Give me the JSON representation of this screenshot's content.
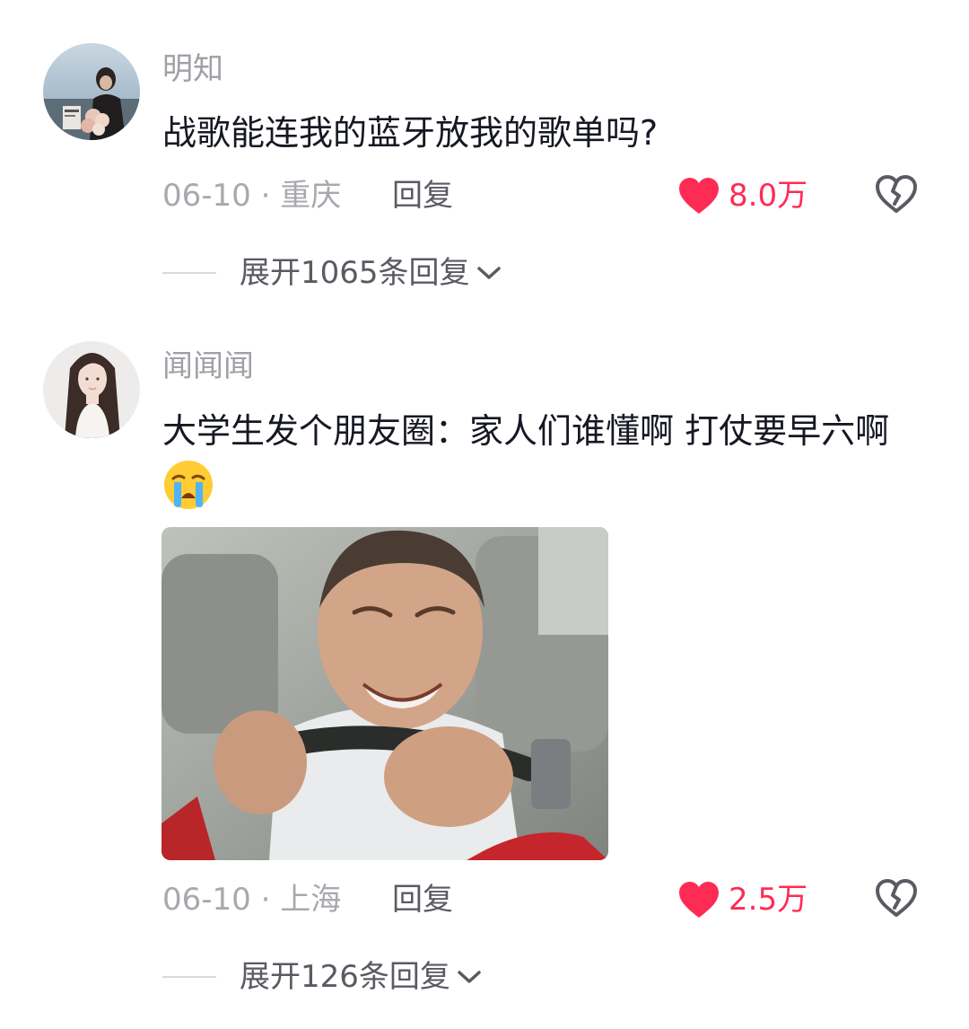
{
  "comments": [
    {
      "username": "明知",
      "text": "战歌能连我的蓝牙放我的歌单吗?",
      "meta": "06-10 · 重庆",
      "reply_label": "回复",
      "likes": "8.0万",
      "expand_label": "展开1065条回复"
    },
    {
      "username": "闻闻闻",
      "text": "大学生发个朋友圈：家人们谁懂啊 打仗要早六啊",
      "emoji": "loudly-crying-face",
      "meta": "06-10 · 上海",
      "reply_label": "回复",
      "likes": "2.5万",
      "expand_label": "展开126条回复"
    }
  ],
  "colors": {
    "like_red": "#fe2c55",
    "meta_gray": "#a8a8ae",
    "text_dark": "#161823"
  }
}
